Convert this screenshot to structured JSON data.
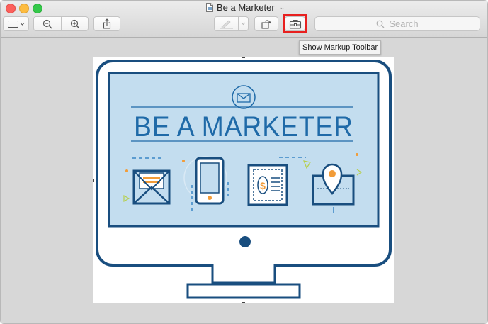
{
  "window": {
    "title": "Be a Marketer"
  },
  "toolbar": {
    "sidebar_button": "sidebar-toggle-icon",
    "zoom_out": "zoom-out-icon",
    "zoom_in": "zoom-in-icon",
    "share": "share-icon",
    "markup_pen": "pen-icon",
    "rotate": "rotate-icon",
    "toolbox": "toolbox-icon",
    "search_placeholder": "Search"
  },
  "tooltip": {
    "text": "Show Markup Toolbar"
  },
  "image": {
    "headline": "BE A MARKETER",
    "colors": {
      "frame": "#194e7f",
      "screen_bg": "#c3ddef",
      "accent_orange": "#f29c38",
      "accent_green": "#b6cf4d"
    }
  },
  "colors": {
    "highlight": "#e8201f",
    "window_bg": "#d7d7d7"
  }
}
